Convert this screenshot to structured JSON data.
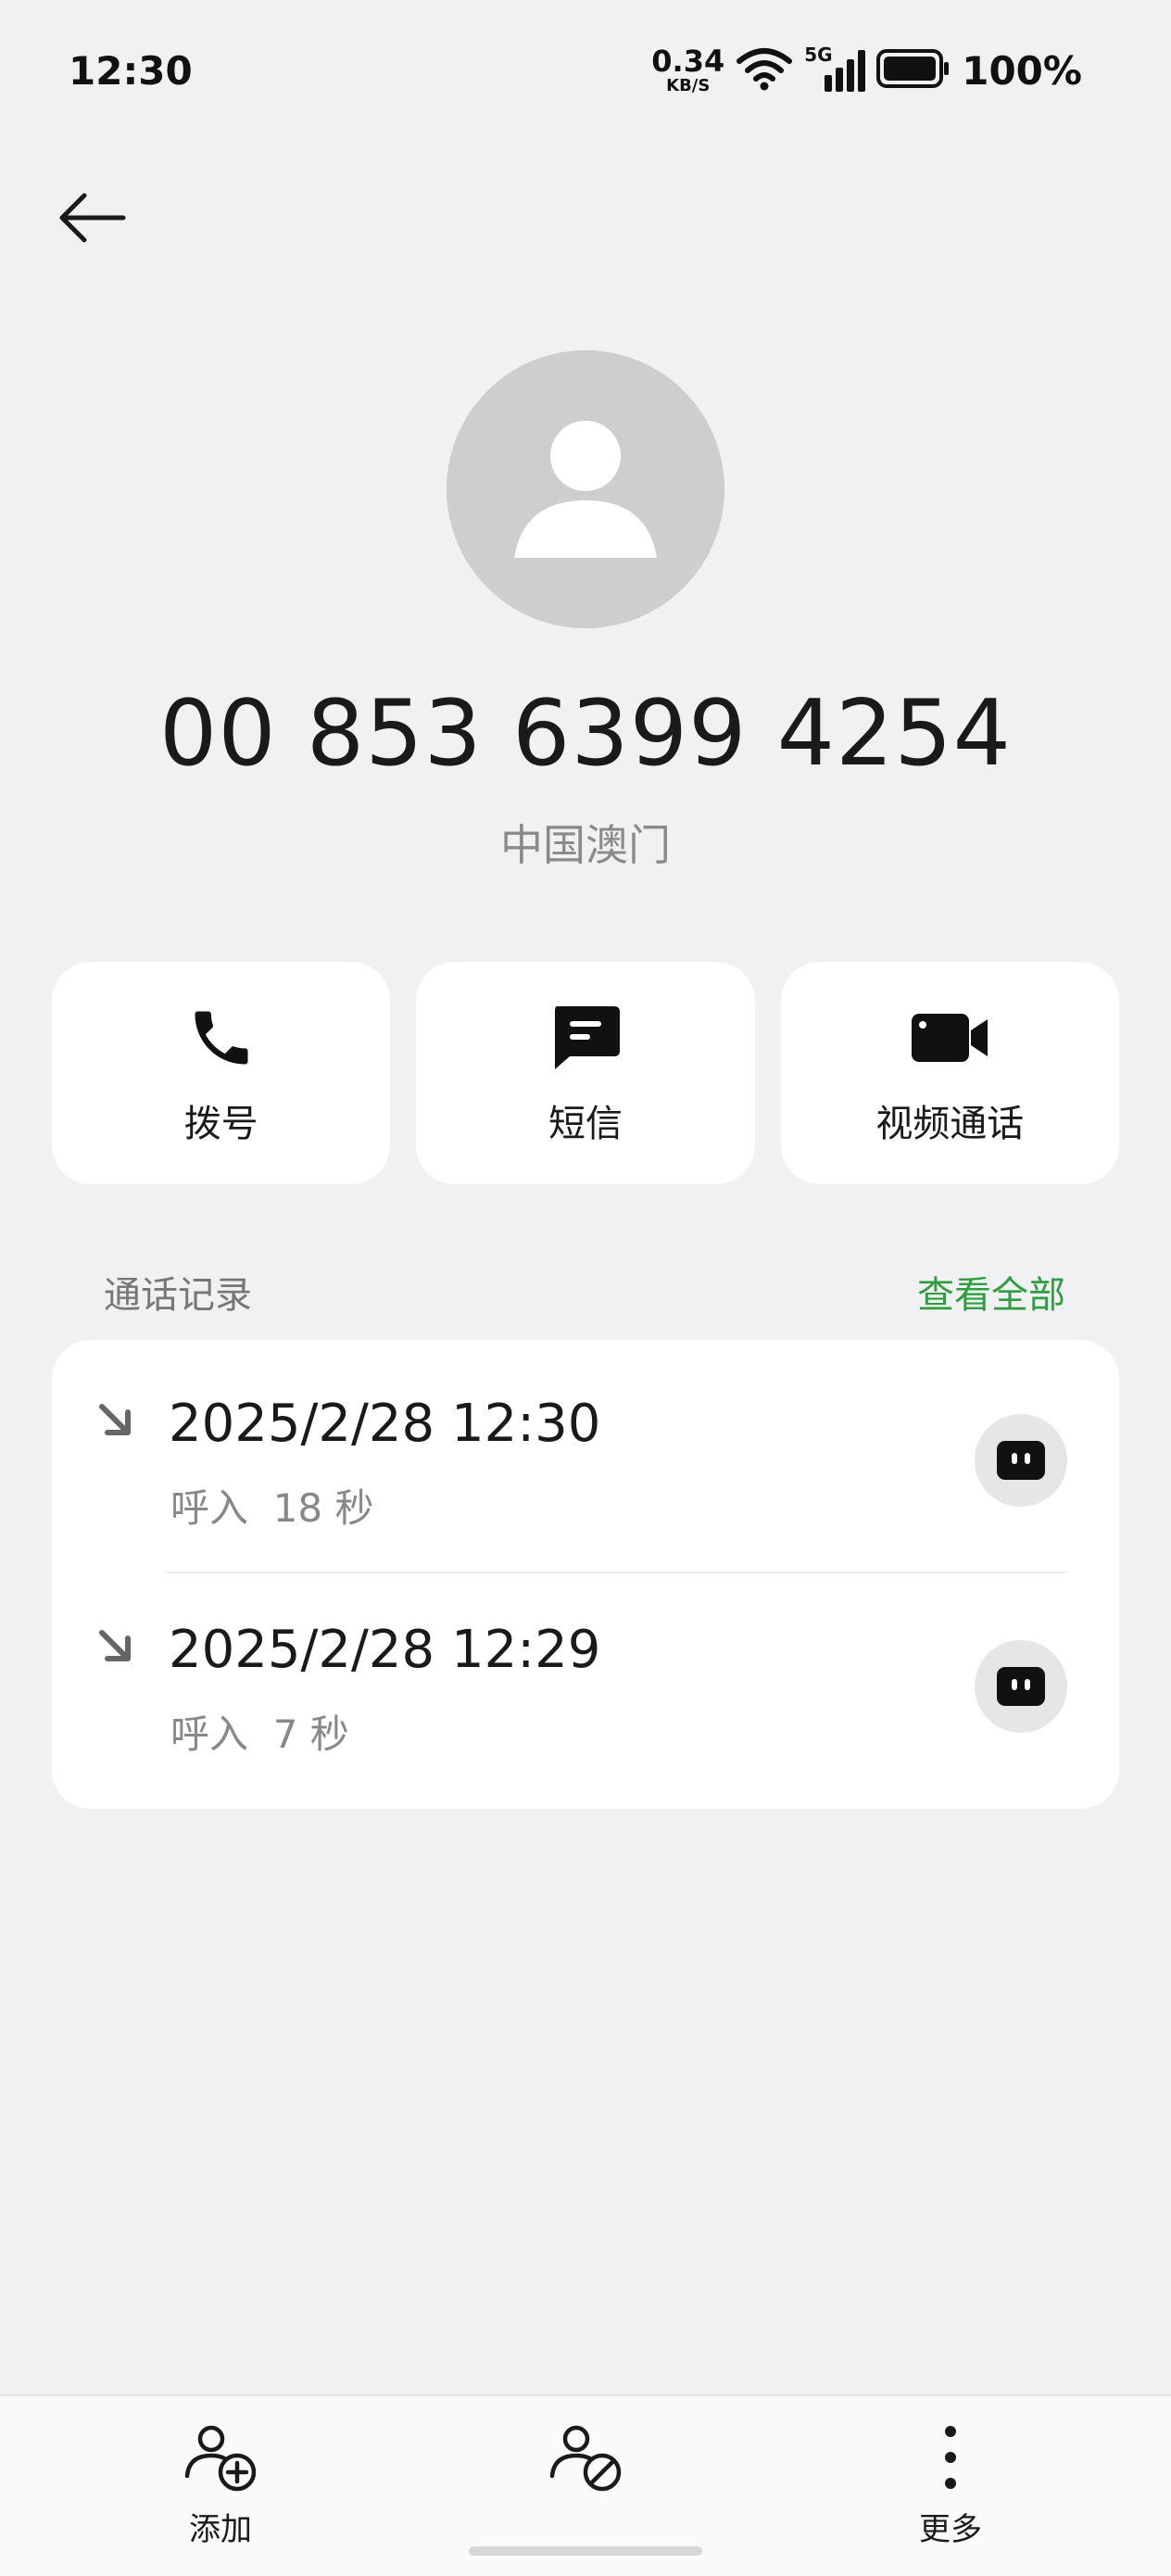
{
  "status_bar": {
    "time": "12:30",
    "net_speed_value": "0.34",
    "net_speed_unit": "KB/S",
    "network_type": "5G",
    "battery_percent": "100%"
  },
  "contact": {
    "avatar_icon": "person-icon",
    "number": "00 853 6399 4254",
    "location": "中国澳门"
  },
  "actions": [
    {
      "label": "拨号",
      "icon": "phone-icon"
    },
    {
      "label": "短信",
      "icon": "message-icon"
    },
    {
      "label": "视频通话",
      "icon": "video-camera-icon"
    }
  ],
  "call_log": {
    "title": "通话记录",
    "view_all": "查看全部",
    "entries": [
      {
        "datetime": "2025/2/28 12:30",
        "detail": "呼入  18 秒",
        "icon": "incoming-call-arrow-icon"
      },
      {
        "datetime": "2025/2/28 12:29",
        "detail": "呼入  7 秒",
        "icon": "incoming-call-arrow-icon"
      }
    ]
  },
  "bottom_bar": {
    "items": [
      {
        "label": "添加",
        "icon": "add-contact-icon"
      },
      {
        "label": "",
        "icon": "block-contact-icon"
      },
      {
        "label": "更多",
        "icon": "more-vertical-icon"
      }
    ]
  },
  "colors": {
    "background": "#f0f1f3",
    "card": "#ffffff",
    "accent_green": "#2e9e3e",
    "avatar_bg": "#cdcecf"
  }
}
